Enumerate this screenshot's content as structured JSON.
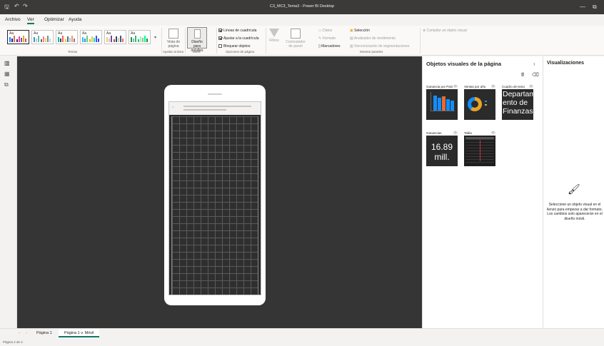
{
  "window": {
    "title": "C3_MC3_Tema3 - Power BI Desktop",
    "minimize": "—",
    "restore": "⧉"
  },
  "menu": {
    "items": [
      "Archivo",
      "Ver",
      "Optimizar",
      "Ayuda"
    ],
    "active": "Ver"
  },
  "ribbon": {
    "themes_label": "Temas",
    "theme_sample_text": "Aa",
    "ajustar_area_label": "Ajustar al área",
    "vista_pagina": "Vista de página",
    "movil_label": "Móvil",
    "diseno_moviles": "Diseño para móviles",
    "opciones_pagina_label": "Opciones de página",
    "lineas_cuadricula": "Líneas de cuadrícula",
    "ajustar_cuadricula": "Ajustar a la cuadrícula",
    "bloquear_objetos": "Bloquear objetos",
    "filtros": "Filtros",
    "conmutador": "Conmutador de panel",
    "datos": "Datos",
    "formato": "Formato",
    "marcadores": "Marcadores",
    "seleccion": "Selección",
    "analizador": "Analizador de rendimiento",
    "sincronizacion": "Sincronización de segmentaciones",
    "mostrar_paneles_label": "Mostrar paneles",
    "compilar": "Compilar un objeto visual"
  },
  "objects_pane": {
    "title": "Objetos visuales de la página",
    "visuals": [
      {
        "title": "Ganancia por País"
      },
      {
        "title": "Ventas por año"
      },
      {
        "title": "Cuadro de texto",
        "text": "Departam ento de Finanzas"
      },
      {
        "title": "Ganancias",
        "value": "16.89 mill."
      },
      {
        "title": "Tabla"
      }
    ]
  },
  "viz_pane": {
    "title": "Visualizaciones",
    "message": "Seleccione un objeto visual en el lienzo para empezar a dar formato. Los cambios solo aparecerán en el diseño móvil."
  },
  "pages": {
    "tabs": [
      "Página 1",
      "Página 1 v. Móvil"
    ],
    "active": "Página 1 v. Móvil"
  },
  "status": "Página 2 de 2",
  "colors": {
    "accent": "#117865",
    "canvas": "#353535",
    "titlebar": "#3b3a39",
    "bar_blue": "#118dff",
    "bar_orange": "#e66c37",
    "donut_orange": "#e8a42a",
    "donut_blue": "#118dff"
  }
}
